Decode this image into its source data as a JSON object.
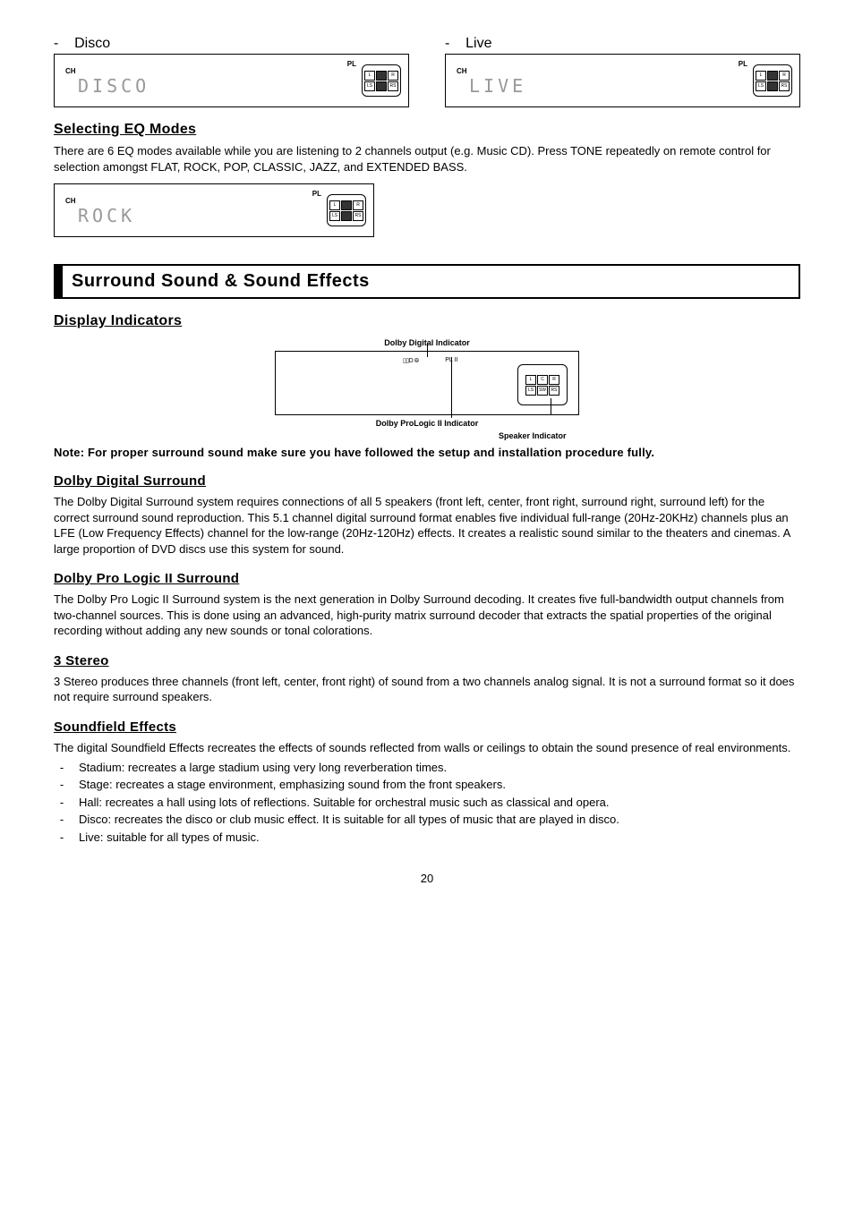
{
  "top_modes": {
    "left": {
      "dash": "-",
      "name": "Disco",
      "ch": "CH",
      "pl": "PL",
      "lcd": "DISCO"
    },
    "right": {
      "dash": "-",
      "name": "Live",
      "ch": "CH",
      "pl": "PL",
      "lcd": "LIVE"
    }
  },
  "eq_section": {
    "heading": "Selecting EQ Modes",
    "para": "There are 6 EQ modes available while you are listening to 2 channels output (e.g. Music CD). Press TONE repeatedly on remote control for selection amongst FLAT, ROCK, POP, CLASSIC, JAZZ, and EXTENDED BASS.",
    "box": {
      "ch": "CH",
      "pl": "PL",
      "lcd": "ROCK"
    }
  },
  "surround_bar": "Surround Sound & Sound Effects",
  "display_indicators": {
    "heading": "Display Indicators",
    "dd_label": "Dolby Digital Indicator",
    "pl_txt": "PL II",
    "dd_txt": "▯▯D ⦾",
    "bottom_label": "Dolby ProLogic II Indicator",
    "spk_label": "Speaker Indicator",
    "spk_cells": [
      "L",
      "C",
      "R",
      "LS",
      "SW",
      "RS"
    ]
  },
  "note": "Note: For proper surround sound make sure you have followed the setup and installation procedure fully.",
  "dds": {
    "heading": "Dolby Digital Surround",
    "para": "The Dolby Digital Surround system requires connections of all 5 speakers (front left, center, front right, surround right, surround left) for the correct surround sound reproduction.  This 5.1 channel digital surround format enables five individual full-range (20Hz-20KHz) channels plus an LFE (Low Frequency Effects) channel for the low-range (20Hz-120Hz) effects.  It creates a realistic sound similar to the theaters and cinemas.  A large proportion of DVD discs use this system for sound."
  },
  "dpl": {
    "heading": "Dolby Pro Logic II Surround",
    "para": "The Dolby Pro Logic II Surround system is the next generation in Dolby Surround decoding. It creates five full-bandwidth output channels from two-channel sources. This is done using an advanced, high-purity matrix surround decoder that extracts the spatial properties of the original recording without adding any new sounds or tonal colorations."
  },
  "stereo3": {
    "heading": "3 Stereo",
    "para": "3 Stereo produces three channels (front left, center, front right) of sound from a two channels analog signal.  It is not a surround format so it does not require surround speakers."
  },
  "sfx": {
    "heading": "Soundfield Effects",
    "intro": "The digital Soundfield Effects recreates the effects of sounds reflected from walls or ceilings to obtain the sound presence of real environments.",
    "items": [
      "Stadium: recreates a large stadium using very long reverberation times.",
      "Stage: recreates a stage environment, emphasizing sound from the front speakers.",
      "Hall: recreates a hall using lots of reflections.  Suitable for orchestral music such as classical and opera.",
      "Disco: recreates the disco or club music effect.  It is suitable for all types of music that are played in disco.",
      "Live: suitable for all types of music."
    ]
  },
  "pagenum": "20",
  "speaker_small": [
    "L",
    "R",
    "LS",
    "SW",
    "RS"
  ]
}
